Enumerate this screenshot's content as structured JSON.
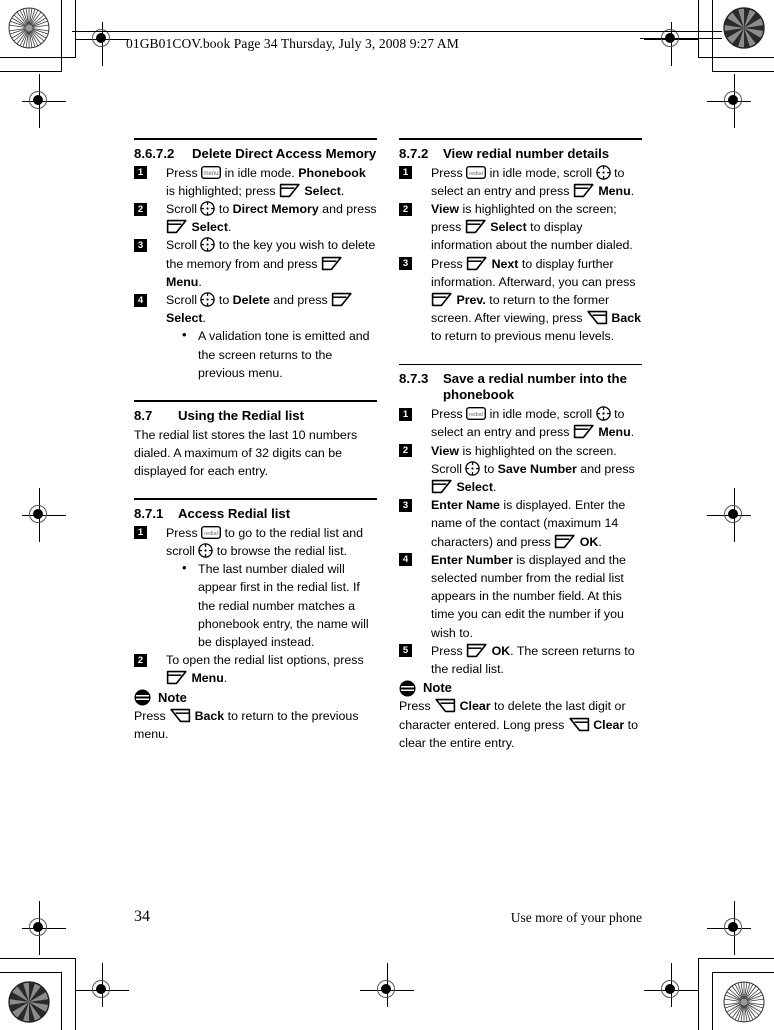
{
  "header": {
    "text": "01GB01COV.book  Page 34  Thursday, July 3, 2008  9:27 AM"
  },
  "footer": {
    "page_number": "34",
    "running_title": "Use more of your phone"
  },
  "icons": {
    "menu_key": "menu",
    "redial_key": "redial",
    "softkey_left": "left-softkey-icon",
    "softkey_right": "right-softkey-icon",
    "scroll": "scroll-navigation-icon",
    "note": "note-icon"
  },
  "left_column": {
    "section_8672": {
      "number": "8.6.7.2",
      "title": "Delete Direct Access Memory",
      "steps": [
        {
          "n": "1",
          "parts": [
            {
              "t": "text",
              "v": "Press "
            },
            {
              "t": "icon",
              "v": "menu_key"
            },
            {
              "t": "text",
              "v": " in idle mode. "
            },
            {
              "t": "bold",
              "v": "Phonebook"
            },
            {
              "t": "text",
              "v": " is highlighted; press "
            },
            {
              "t": "icon",
              "v": "softkey_left"
            },
            {
              "t": "bold",
              "v": " Select"
            },
            {
              "t": "text",
              "v": "."
            }
          ]
        },
        {
          "n": "2",
          "parts": [
            {
              "t": "text",
              "v": "Scroll "
            },
            {
              "t": "icon",
              "v": "scroll"
            },
            {
              "t": "text",
              "v": " to "
            },
            {
              "t": "bold",
              "v": "Direct Memory"
            },
            {
              "t": "text",
              "v": " and press "
            },
            {
              "t": "icon",
              "v": "softkey_left"
            },
            {
              "t": "bold",
              "v": " Select"
            },
            {
              "t": "text",
              "v": "."
            }
          ]
        },
        {
          "n": "3",
          "parts": [
            {
              "t": "text",
              "v": "Scroll "
            },
            {
              "t": "icon",
              "v": "scroll"
            },
            {
              "t": "text",
              "v": " to the key you wish to delete the memory from and press "
            },
            {
              "t": "icon",
              "v": "softkey_left"
            },
            {
              "t": "bold",
              "v": " Menu"
            },
            {
              "t": "text",
              "v": "."
            }
          ]
        },
        {
          "n": "4",
          "parts": [
            {
              "t": "text",
              "v": "Scroll "
            },
            {
              "t": "icon",
              "v": "scroll"
            },
            {
              "t": "text",
              "v": " to "
            },
            {
              "t": "bold",
              "v": "Delete"
            },
            {
              "t": "text",
              "v": " and press "
            },
            {
              "t": "icon",
              "v": "softkey_left"
            },
            {
              "t": "bold",
              "v": " Select"
            },
            {
              "t": "text",
              "v": "."
            }
          ],
          "bullets": [
            "A validation tone is emitted and the screen returns to the previous menu."
          ]
        }
      ]
    },
    "section_87": {
      "number": "8.7",
      "title": "Using the Redial list",
      "body": "The redial list stores the last 10 numbers dialed. A maximum of 32 digits can be displayed for each entry."
    },
    "section_871": {
      "number": "8.7.1",
      "title": "Access Redial list",
      "steps": [
        {
          "n": "1",
          "parts": [
            {
              "t": "text",
              "v": "Press "
            },
            {
              "t": "icon",
              "v": "redial_key"
            },
            {
              "t": "text",
              "v": " to go to the redial list and scroll "
            },
            {
              "t": "icon",
              "v": "scroll"
            },
            {
              "t": "text",
              "v": " to browse the redial list."
            }
          ],
          "bullets": [
            "The last number dialed will appear first in the redial list. If the redial number matches a phonebook entry, the name will be displayed instead."
          ]
        },
        {
          "n": "2",
          "parts": [
            {
              "t": "text",
              "v": "To open the redial list options, press "
            },
            {
              "t": "icon",
              "v": "softkey_left"
            },
            {
              "t": "bold",
              "v": " Menu"
            },
            {
              "t": "text",
              "v": "."
            }
          ]
        }
      ],
      "note": {
        "label": "Note",
        "parts": [
          {
            "t": "text",
            "v": "Press "
          },
          {
            "t": "icon",
            "v": "softkey_right"
          },
          {
            "t": "bold",
            "v": " Back"
          },
          {
            "t": "text",
            "v": " to return to the previous menu."
          }
        ]
      }
    }
  },
  "right_column": {
    "section_872": {
      "number": "8.7.2",
      "title": "View redial number details",
      "steps": [
        {
          "n": "1",
          "parts": [
            {
              "t": "text",
              "v": "Press "
            },
            {
              "t": "icon",
              "v": "redial_key"
            },
            {
              "t": "text",
              "v": " in idle mode, scroll "
            },
            {
              "t": "icon",
              "v": "scroll"
            },
            {
              "t": "text",
              "v": " to select an entry and press "
            },
            {
              "t": "icon",
              "v": "softkey_left"
            },
            {
              "t": "bold",
              "v": " Menu"
            },
            {
              "t": "text",
              "v": "."
            }
          ]
        },
        {
          "n": "2",
          "parts": [
            {
              "t": "bold",
              "v": "View"
            },
            {
              "t": "text",
              "v": " is highlighted on the screen; press "
            },
            {
              "t": "icon",
              "v": "softkey_left"
            },
            {
              "t": "bold",
              "v": " Select"
            },
            {
              "t": "text",
              "v": " to display information about the number dialed."
            }
          ]
        },
        {
          "n": "3",
          "parts": [
            {
              "t": "text",
              "v": "Press "
            },
            {
              "t": "icon",
              "v": "softkey_left"
            },
            {
              "t": "bold",
              "v": " Next"
            },
            {
              "t": "text",
              "v": " to display further information. Afterward, you can press "
            },
            {
              "t": "icon",
              "v": "softkey_left"
            },
            {
              "t": "bold",
              "v": " Prev."
            },
            {
              "t": "text",
              "v": " to return to the former screen. After viewing, press "
            },
            {
              "t": "icon",
              "v": "softkey_right"
            },
            {
              "t": "bold",
              "v": " Back"
            },
            {
              "t": "text",
              "v": " to return to previous menu levels."
            }
          ]
        }
      ]
    },
    "section_873": {
      "number": "8.7.3",
      "title": "Save a redial number into the phonebook",
      "steps": [
        {
          "n": "1",
          "parts": [
            {
              "t": "text",
              "v": "Press "
            },
            {
              "t": "icon",
              "v": "redial_key"
            },
            {
              "t": "text",
              "v": " in idle mode, scroll "
            },
            {
              "t": "icon",
              "v": "scroll"
            },
            {
              "t": "text",
              "v": " to select an entry and press "
            },
            {
              "t": "icon",
              "v": "softkey_left"
            },
            {
              "t": "bold",
              "v": " Menu"
            },
            {
              "t": "text",
              "v": "."
            }
          ]
        },
        {
          "n": "2",
          "parts": [
            {
              "t": "bold",
              "v": "View"
            },
            {
              "t": "text",
              "v": " is highlighted on the screen. Scroll "
            },
            {
              "t": "icon",
              "v": "scroll"
            },
            {
              "t": "text",
              "v": " to "
            },
            {
              "t": "bold",
              "v": "Save Number"
            },
            {
              "t": "text",
              "v": " and press "
            },
            {
              "t": "icon",
              "v": "softkey_left"
            },
            {
              "t": "bold",
              "v": " Select"
            },
            {
              "t": "text",
              "v": "."
            }
          ]
        },
        {
          "n": "3",
          "parts": [
            {
              "t": "bold",
              "v": "Enter Name"
            },
            {
              "t": "text",
              "v": " is displayed. Enter the name of the contact (maximum 14 characters) and press "
            },
            {
              "t": "icon",
              "v": "softkey_left"
            },
            {
              "t": "bold",
              "v": " OK"
            },
            {
              "t": "text",
              "v": "."
            }
          ]
        },
        {
          "n": "4",
          "parts": [
            {
              "t": "bold",
              "v": "Enter Number"
            },
            {
              "t": "text",
              "v": " is displayed and the selected number from the redial list appears in the number field. At this time you can edit the number if you wish to."
            }
          ]
        },
        {
          "n": "5",
          "parts": [
            {
              "t": "text",
              "v": "Press "
            },
            {
              "t": "icon",
              "v": "softkey_left"
            },
            {
              "t": "bold",
              "v": " OK"
            },
            {
              "t": "text",
              "v": ". The screen returns to the redial list."
            }
          ]
        }
      ],
      "note": {
        "label": "Note",
        "parts": [
          {
            "t": "text",
            "v": "Press "
          },
          {
            "t": "icon",
            "v": "softkey_right"
          },
          {
            "t": "bold",
            "v": " Clear"
          },
          {
            "t": "text",
            "v": " to delete the last digit or character entered. Long press "
          },
          {
            "t": "icon",
            "v": "softkey_right"
          },
          {
            "t": "bold",
            "v": " Clear"
          },
          {
            "t": "text",
            "v": " to clear the entire entry."
          }
        ]
      }
    }
  }
}
